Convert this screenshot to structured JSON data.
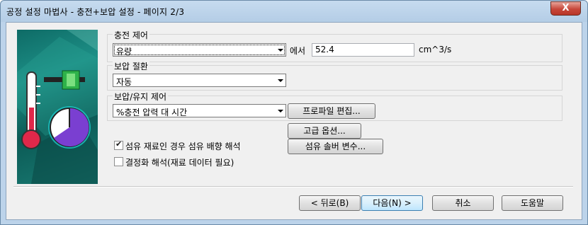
{
  "window": {
    "title": "공정 설정 마법사 - 충전+보압 설정 - 페이지 2/3",
    "close_label": "X"
  },
  "fill_control": {
    "label": "충전 제어",
    "selected": "유량",
    "suffix": "에서",
    "value": "52.4",
    "unit": "cm^3/s"
  },
  "switchover": {
    "label": "보압 절환",
    "selected": "자동"
  },
  "pack_control": {
    "label": "보압/유지 제어",
    "selected": "%충전 압력 대 시간",
    "edit_profile_button": "프로파일 편집..."
  },
  "advanced_options_button": "고급 옵션...",
  "fiber_solver_button": "섬유 솔버 변수...",
  "fiber_orientation": {
    "label": "섬유 재료인 경우 섬유 배향 해석",
    "checked": true
  },
  "crystallization": {
    "label": "결정화 해석(재료 데이터 필요)",
    "checked": false
  },
  "footer": {
    "back": "< 뒤로(B)",
    "next": "다음(N) >",
    "cancel": "취소",
    "help": "도움말"
  },
  "icons": [
    "close-icon",
    "thermometer-icon",
    "clock-icon",
    "valve-icon",
    "dropdown-arrow-icon",
    "checkmark-icon"
  ]
}
